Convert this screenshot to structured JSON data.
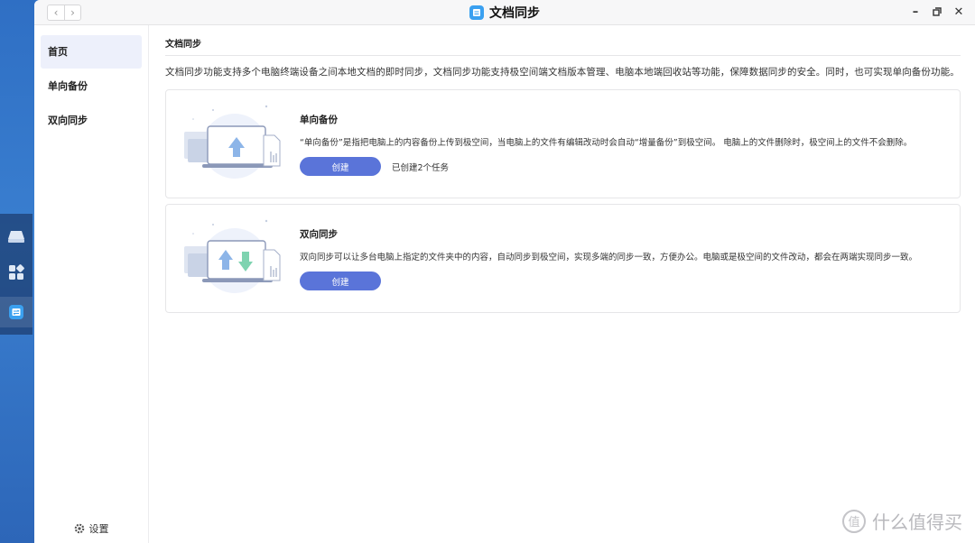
{
  "window": {
    "title": "文档同步"
  },
  "sidebar": {
    "items": [
      {
        "label": "首页"
      },
      {
        "label": "单向备份"
      },
      {
        "label": "双向同步"
      }
    ],
    "settings_label": "设置"
  },
  "main": {
    "section_title": "文档同步",
    "description": "文档同步功能支持多个电脑终端设备之间本地文档的即时同步，文档同步功能支持极空间端文档版本管理、电脑本地端回收站等功能，保障数据同步的安全。同时，也可实现单向备份功能。",
    "cards": [
      {
        "title": "单向备份",
        "desc": "“单向备份”是指把电脑上的内容备份上传到极空间，当电脑上的文件有编辑改动时会自动“增量备份”到极空间。 电脑上的文件删除时，极空间上的文件不会删除。",
        "button": "创建",
        "status": "已创建2个任务"
      },
      {
        "title": "双向同步",
        "desc": "双向同步可以让多台电脑上指定的文件夹中的内容，自动同步到极空间，实现多端的同步一致，方便办公。电脑或是极空间的文件改动，都会在两端实现同步一致。",
        "button": "创建"
      }
    ]
  },
  "watermark": {
    "text": "什么值得买"
  },
  "colors": {
    "accent": "#5a74d9",
    "desktop": "#3a7fd0",
    "sidebar_active": "#edf0fb"
  }
}
